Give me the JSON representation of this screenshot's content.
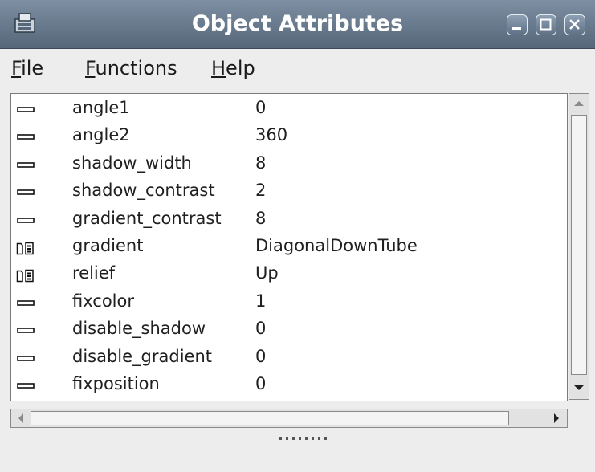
{
  "window": {
    "title": "Object Attributes",
    "icon": "app-icon",
    "controls": [
      "minimize-icon",
      "maximize-icon",
      "close-icon"
    ]
  },
  "menu": {
    "items": [
      {
        "mnemonic": "F",
        "rest": "ile"
      },
      {
        "mnemonic": "F",
        "rest": "unctions"
      },
      {
        "mnemonic": "H",
        "rest": "elp"
      }
    ]
  },
  "attributes": {
    "rows": [
      {
        "icon": "dash-icon",
        "name": "angle1",
        "value": "0"
      },
      {
        "icon": "dash-icon",
        "name": "angle2",
        "value": "360"
      },
      {
        "icon": "dash-icon",
        "name": "shadow_width",
        "value": "8"
      },
      {
        "icon": "dash-icon",
        "name": "shadow_contrast",
        "value": "2"
      },
      {
        "icon": "dash-icon",
        "name": "gradient_contrast",
        "value": "8"
      },
      {
        "icon": "enum-list-icon",
        "name": "gradient",
        "value": "DiagonalDownTube"
      },
      {
        "icon": "enum-list-icon",
        "name": "relief",
        "value": "Up"
      },
      {
        "icon": "dash-icon",
        "name": "fixcolor",
        "value": "1"
      },
      {
        "icon": "dash-icon",
        "name": "disable_shadow",
        "value": "0"
      },
      {
        "icon": "dash-icon",
        "name": "disable_gradient",
        "value": "0"
      },
      {
        "icon": "dash-icon",
        "name": "fixposition",
        "value": "0"
      }
    ]
  },
  "colors": {
    "titlebar": "#667a90",
    "list_background": "#ffffff",
    "window_background": "#ededed"
  }
}
